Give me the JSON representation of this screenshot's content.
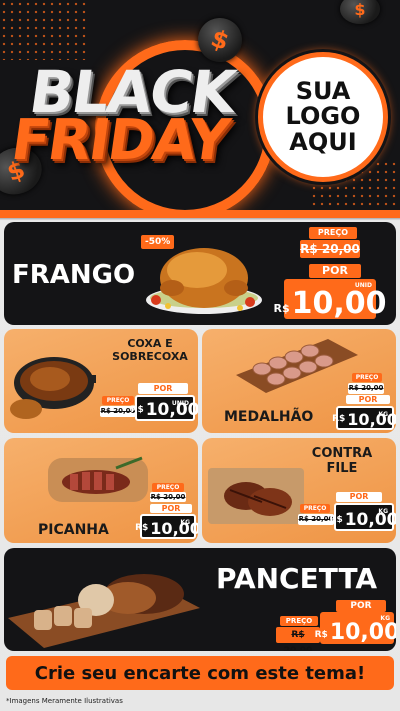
{
  "header": {
    "title_line1": "BLACK",
    "title_line2": "FRIDAY",
    "logo_line1": "SUA",
    "logo_line2": "LOGO",
    "logo_line3": "AQUI",
    "coin_symbol": "$"
  },
  "products": {
    "frango": {
      "name": "FRANGO",
      "discount": "-50%",
      "preco_label": "PREÇO",
      "old_price": "R$ 20,00",
      "por_label": "POR",
      "currency": "R$",
      "price": "10,00",
      "unit": "UNID"
    },
    "coxa": {
      "name_line1": "COXA E",
      "name_line2": "SOBRECOXA",
      "preco_label": "PREÇO",
      "old_price": "R$ 20,00",
      "por_label": "POR",
      "currency": "R$",
      "price": "10,00",
      "unit": "UNID"
    },
    "medalhao": {
      "name": "MEDALHÃO",
      "preco_label": "PREÇO",
      "old_price": "R$ 20,00",
      "por_label": "POR",
      "currency": "R$",
      "price": "10,00",
      "unit": "KG"
    },
    "picanha": {
      "name": "PICANHA",
      "preco_label": "PREÇO",
      "old_price": "R$ 20,00",
      "por_label": "POR",
      "currency": "R$",
      "price": "10,00",
      "unit": "KG"
    },
    "contrafile": {
      "name_line1": "CONTRA",
      "name_line2": "FILE",
      "preco_label": "PREÇO",
      "old_price": "R$ 20,00",
      "por_label": "POR",
      "currency": "R$",
      "price": "10,00",
      "unit": "KG"
    },
    "pancetta": {
      "name": "PANCETTA",
      "preco_label": "PREÇO",
      "old_price": "R$ 20,00",
      "por_label": "POR",
      "currency": "R$",
      "price": "10,00",
      "unit": "KG"
    }
  },
  "footer": {
    "cta": "Crie seu encarte com este tema!",
    "disclaimer": "*Imagens Meramente Ilustrativas"
  },
  "colors": {
    "accent": "#ff6a1a",
    "dark": "#141416",
    "tan": "#f3a25a"
  }
}
